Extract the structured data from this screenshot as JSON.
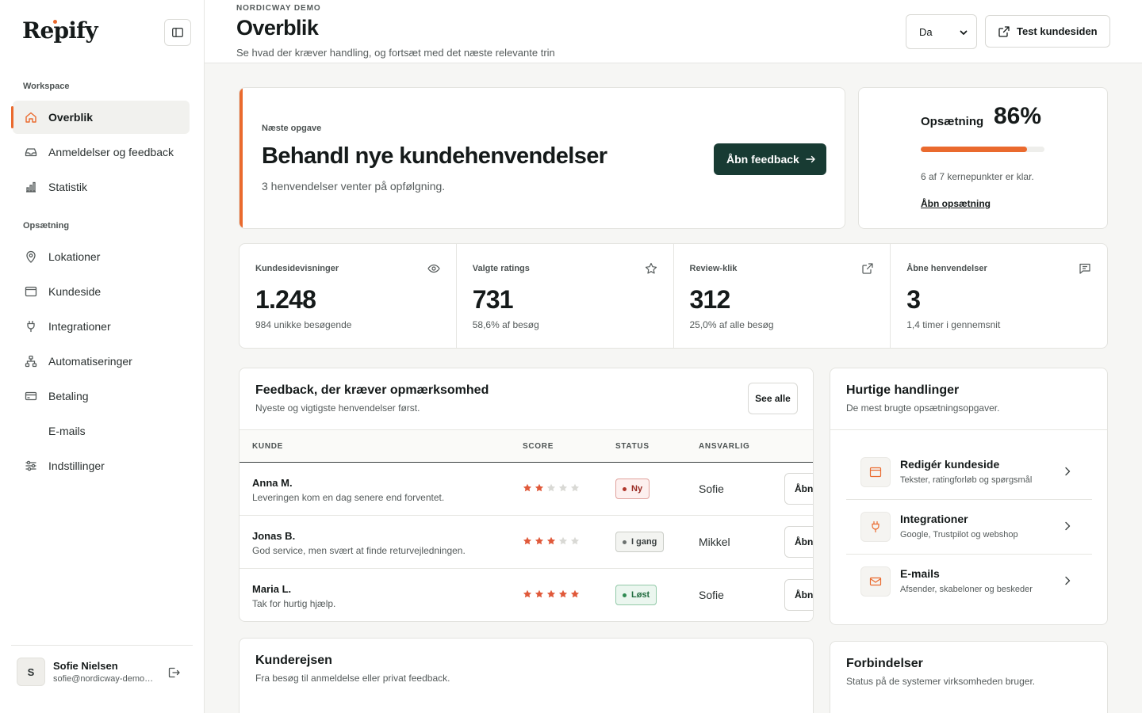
{
  "sidebar": {
    "logo": "Repify",
    "sections": {
      "workspace": "Workspace",
      "setup": "Opsætning"
    },
    "items": [
      {
        "label": "Overblik",
        "icon": "home-icon"
      },
      {
        "label": "Anmeldelser og feedback",
        "icon": "inbox-icon"
      },
      {
        "label": "Statistik",
        "icon": "bar-chart-icon"
      },
      {
        "label": "Lokationer",
        "icon": "map-pin-icon"
      },
      {
        "label": "Kundeside",
        "icon": "browser-window-icon"
      },
      {
        "label": "Integrationer",
        "icon": "plug-icon"
      },
      {
        "label": "Automatiseringer",
        "icon": "workflow-icon"
      },
      {
        "label": "Betaling",
        "icon": "credit-card-icon"
      },
      {
        "label": "E-mails",
        "icon": ""
      },
      {
        "label": "Indstillinger",
        "icon": "sliders-icon"
      }
    ],
    "user": {
      "initial": "S",
      "name": "Sofie Nielsen",
      "email": "sofie@nordicway-demo.com"
    }
  },
  "header": {
    "eyebrow": "NORDICWAY DEMO",
    "title": "Overblik",
    "subtitle": "Se hvad der kræver handling, og fortsæt med det næste relevante trin",
    "language": "Da",
    "test_button": "Test kundesiden"
  },
  "next_task": {
    "label": "Næste opgave",
    "title": "Behandl nye kundehenvendelser",
    "subtitle": "3 henvendelser venter på opfølgning.",
    "button": "Åbn feedback"
  },
  "setup": {
    "label": "Opsætning",
    "percent_label": "86%",
    "progress": 0.86,
    "note": "6 af 7 kernepunkter er klar.",
    "link": "Åbn opsætning"
  },
  "stats": [
    {
      "label": "Kundesidevisninger",
      "value": "1.248",
      "sub": "984 unikke besøgende",
      "icon": "eye-icon"
    },
    {
      "label": "Valgte ratings",
      "value": "731",
      "sub": "58,6% af besøg",
      "icon": "star-icon"
    },
    {
      "label": "Review-klik",
      "value": "312",
      "sub": "25,0% af alle besøg",
      "icon": "external-link-icon"
    },
    {
      "label": "Åbne henvendelser",
      "value": "3",
      "sub": "1,4 timer i gennemsnit",
      "icon": "message-icon"
    }
  ],
  "feedback": {
    "title": "Feedback, der kræver opmærksomhed",
    "subtitle": "Nyeste og vigtigste henvendelser først.",
    "see_all": "See alle",
    "columns": [
      "KUNDE",
      "SCORE",
      "STATUS",
      "ANSVARLIG"
    ],
    "rows": [
      {
        "name": "Anna M.",
        "message": "Leveringen kom en dag senere end forventet.",
        "score": 2,
        "status": "Ny",
        "assignee": "Sofie",
        "action": "Åbn"
      },
      {
        "name": "Jonas B.",
        "message": "God service, men svært at finde returvejledningen.",
        "score": 3,
        "status": "I gang",
        "assignee": "Mikkel",
        "action": "Åbn"
      },
      {
        "name": "Maria L.",
        "message": "Tak for hurtig hjælp.",
        "score": 5,
        "status": "Løst",
        "assignee": "Sofie",
        "action": "Åbn"
      }
    ]
  },
  "quick_actions": {
    "title": "Hurtige handlinger",
    "subtitle": "De mest brugte opsætningsopgaver.",
    "items": [
      {
        "title": "Redigér kundeside",
        "sub": "Tekster, ratingforløb og spørgsmål",
        "icon": "browser-window-icon"
      },
      {
        "title": "Integrationer",
        "sub": "Google, Trustpilot og webshop",
        "icon": "plug-icon"
      },
      {
        "title": "E-mails",
        "sub": "Afsender, skabeloner og beskeder",
        "icon": "mail-icon"
      }
    ]
  },
  "journey": {
    "title": "Kunderejsen",
    "subtitle": "Fra besøg til anmeldelse eller privat feedback."
  },
  "connections": {
    "title": "Forbindelser",
    "subtitle": "Status på de systemer virksomheden bruger."
  },
  "colors": {
    "accent": "#ea6a2e",
    "primary_button": "#183b33",
    "star": "#e0593a"
  }
}
